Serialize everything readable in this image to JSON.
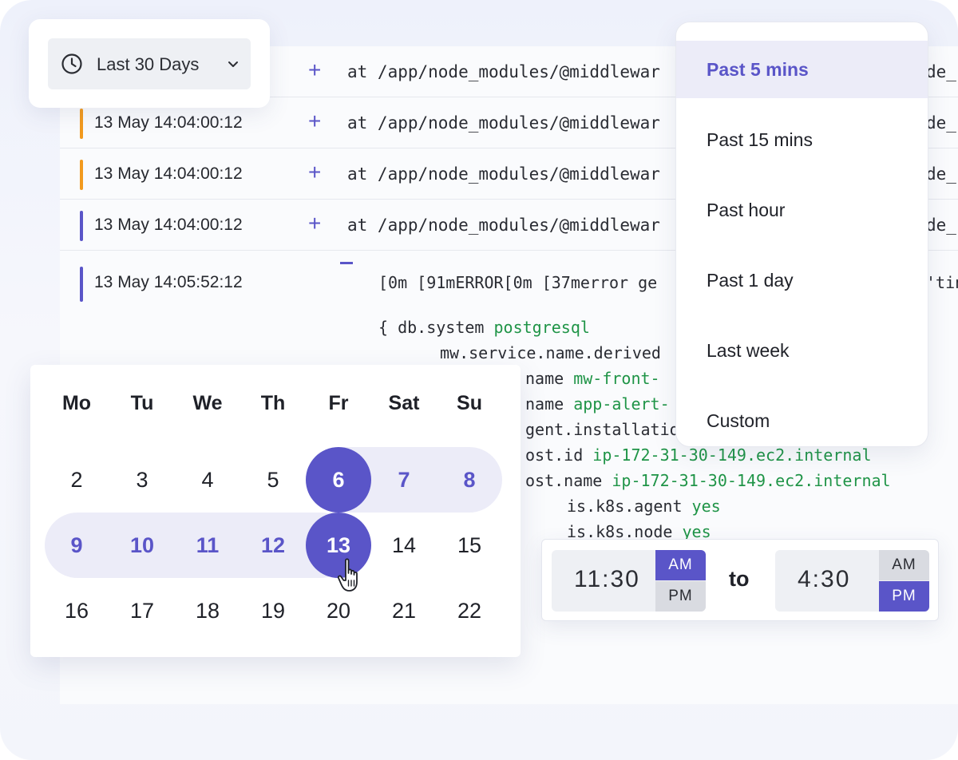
{
  "date_range": {
    "label": "Last 30 Days",
    "icon": "clock-icon"
  },
  "logs": {
    "rows": [
      {
        "time": "",
        "message": "at /app/node_modules/@middlewar",
        "tail": "de_",
        "bar_color": ""
      },
      {
        "time": "13 May 14:04:00:12",
        "message": "at /app/node_modules/@middlewar",
        "tail": "de_",
        "bar_color": "#f29a1e"
      },
      {
        "time": "13 May 14:04:00:12",
        "message": "at /app/node_modules/@middlewar",
        "tail": "de_",
        "bar_color": "#f29a1e"
      },
      {
        "time": "13 May 14:04:00:12",
        "message": "at /app/node_modules/@middlewar",
        "tail": "de_",
        "bar_color": "#5a55c8"
      }
    ],
    "expanded": {
      "time": "13 May 14:05:52:12",
      "bar_color": "#5a55c8",
      "header": "[0m [91mERROR[0m [37merror ge",
      "header_tail": "'tin",
      "open": "{ db.system",
      "open_value": "postgresql",
      "service": "mw.service.name.derived",
      "name1_key": "name",
      "name1_value": "mw-front-",
      "name2_key": "name",
      "name2_value": "app-alert-",
      "agent": "gent.installation",
      "host_id_key": "ost.id",
      "host_id_value": "ip-172-31-30-149.ec2.internal",
      "host_name_key": "ost.name",
      "host_name_value": "ip-172-31-30-149.ec2.internal",
      "k8s_agent_key": "is.k8s.agent",
      "k8s_agent_value": "yes",
      "k8s_node_key": "is.k8s.node",
      "k8s_node_value": "yes"
    }
  },
  "dropdown": {
    "items": [
      "Past 5 mins",
      "Past 15 mins",
      "Past hour",
      "Past 1 day",
      "Last week",
      "Custom"
    ],
    "active_index": 0
  },
  "calendar": {
    "weekdays": [
      "Mo",
      "Tu",
      "We",
      "Th",
      "Fr",
      "Sat",
      "Su"
    ],
    "weeks": [
      [
        "2",
        "3",
        "4",
        "5",
        "6",
        "7",
        "8"
      ],
      [
        "9",
        "10",
        "11",
        "12",
        "13",
        "14",
        "15"
      ],
      [
        "16",
        "17",
        "18",
        "19",
        "20",
        "21",
        "22"
      ]
    ],
    "range_start": "6",
    "range_end": "13"
  },
  "time": {
    "from": {
      "value": "11:30",
      "am": "AM",
      "pm": "PM",
      "selected": "AM"
    },
    "to_label": "to",
    "to": {
      "value": "4:30",
      "am": "AM",
      "pm": "PM",
      "selected": "PM"
    }
  },
  "colors": {
    "accent": "#5a55c8",
    "accent_light": "#ececf8",
    "warn": "#f29a1e",
    "value_green": "#1f9447"
  }
}
